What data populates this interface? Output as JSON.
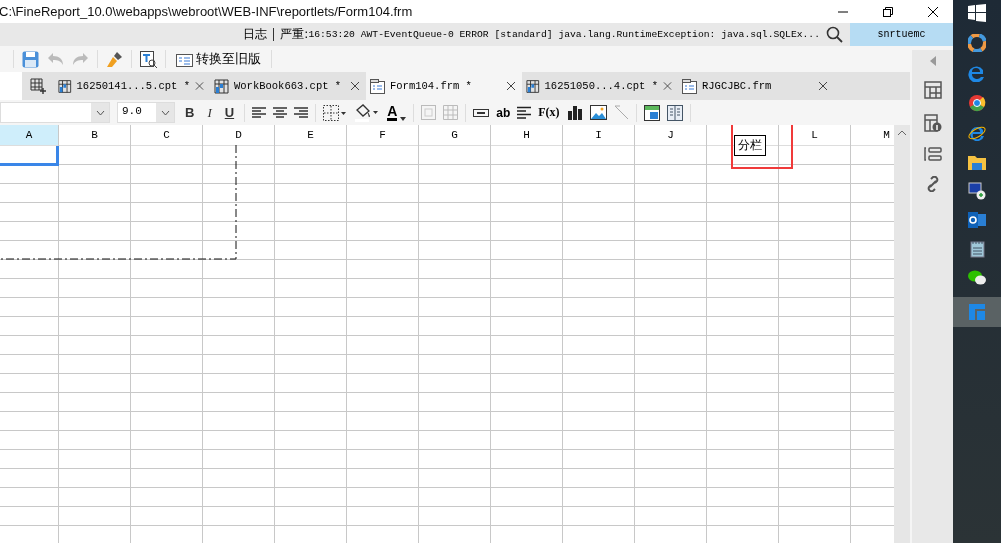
{
  "window": {
    "title": "C:\\FineReport_10.0\\webapps\\webroot\\WEB-INF\\reportlets/Form104.frm"
  },
  "log_bar": {
    "label": "日志",
    "level": "严重:",
    "message": "16:53:20 AWT-EventQueue-0 ERROR [standard] java.lang.RuntimeException: java.sql.SQLEx...",
    "user": "snrtuemc"
  },
  "toolbar": {
    "convert_label": "转换至旧版"
  },
  "tabs": [
    {
      "kind": "cpt",
      "label": "16250141...5.cpt *",
      "selected": false
    },
    {
      "kind": "cpt",
      "label": "WorkBook663.cpt *",
      "selected": false
    },
    {
      "kind": "frm",
      "label": "Form104.frm *",
      "selected": true
    },
    {
      "kind": "cpt",
      "label": "16251050...4.cpt *",
      "selected": false
    },
    {
      "kind": "frm",
      "label": "RJGCJBC.frm",
      "selected": false
    }
  ],
  "format_bar": {
    "font_size": "9.0",
    "bold": "B",
    "italic": "I",
    "underline": "U",
    "font_color": "A",
    "text_widget": "ab",
    "formula": "F(x)"
  },
  "tooltip": "分栏",
  "columns": [
    {
      "label": "A",
      "selected": true
    },
    {
      "label": "B",
      "selected": false
    },
    {
      "label": "C",
      "selected": false
    },
    {
      "label": "D",
      "selected": false
    },
    {
      "label": "E",
      "selected": false
    },
    {
      "label": "F",
      "selected": false
    },
    {
      "label": "G",
      "selected": false
    },
    {
      "label": "H",
      "selected": false
    },
    {
      "label": "I",
      "selected": false
    },
    {
      "label": "J",
      "selected": false
    },
    {
      "selected": false
    },
    {
      "label": "L",
      "selected": false
    },
    {
      "label": "M",
      "selected": false
    }
  ]
}
